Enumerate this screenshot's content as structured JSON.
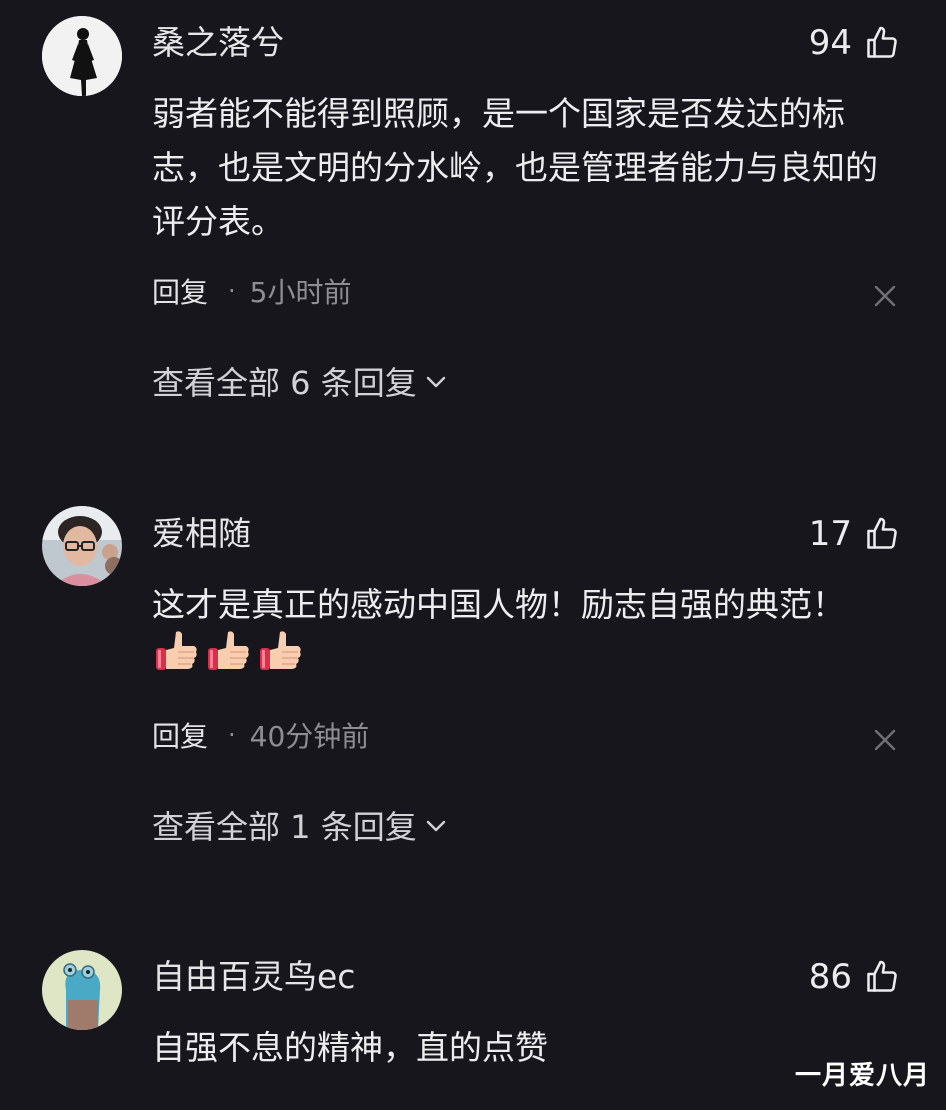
{
  "comments": [
    {
      "username": "桑之落兮",
      "likes": "94",
      "text": "弱者能不能得到照顾，是一个国家是否发达的标志，也是文明的分水岭，也是管理者能力与良知的评分表。",
      "reply_label": "回复",
      "separator": "·",
      "time": "5小时前",
      "view_replies": "查看全部 6 条回复",
      "avatar_icon": "woman-silhouette-avatar"
    },
    {
      "username": "爱相随",
      "likes": "17",
      "text": "这才是真正的感动中国人物！励志自强的典范！",
      "emojis": [
        "thumbs-up",
        "thumbs-up",
        "thumbs-up"
      ],
      "reply_label": "回复",
      "separator": "·",
      "time": "40分钟前",
      "view_replies": "查看全部 1 条回复",
      "avatar_icon": "photo-avatar"
    },
    {
      "username": "自由百灵鸟ec",
      "likes": "86",
      "text": "自强不息的精神，直的点赞",
      "avatar_icon": "cartoon-avatar"
    }
  ],
  "watermark": "一月爱八月",
  "colors": {
    "background": "#16161c",
    "primary_text": "#ededef",
    "secondary_text": "#8d8d93"
  }
}
